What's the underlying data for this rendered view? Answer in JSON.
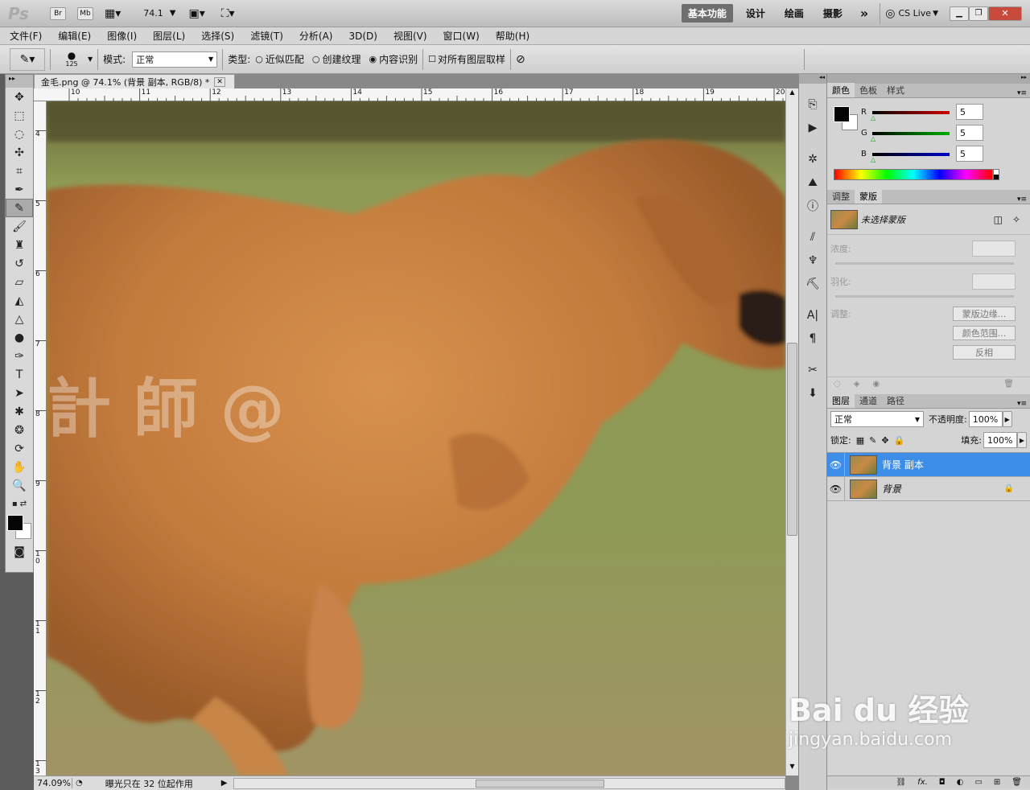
{
  "appbar": {
    "logo": "Ps",
    "zoom": "74.1",
    "workspaces": [
      "基本功能",
      "设计",
      "绘画",
      "摄影"
    ],
    "more": "»",
    "cslive": "CS Live"
  },
  "menu": [
    "文件(F)",
    "编辑(E)",
    "图像(I)",
    "图层(L)",
    "选择(S)",
    "滤镜(T)",
    "分析(A)",
    "3D(D)",
    "视图(V)",
    "窗口(W)",
    "帮助(H)"
  ],
  "options": {
    "brush_size": "125",
    "mode_label": "模式:",
    "mode_value": "正常",
    "type_label": "类型:",
    "type_options": [
      "近似匹配",
      "创建纹理",
      "内容识别"
    ],
    "type_selected": 2,
    "sample_all_label": "对所有图层取样"
  },
  "document": {
    "tab_title": "金毛.png @ 74.1% (背景 副本, RGB/8) *",
    "ruler_h": [
      "10",
      "11",
      "12",
      "13",
      "14",
      "15",
      "16",
      "17",
      "18",
      "19",
      "20"
    ],
    "ruler_v": [
      "4",
      "5",
      "6",
      "7",
      "8",
      "9",
      "1\n0",
      "1\n1",
      "1\n2",
      "1\n3"
    ],
    "watermark_text": "計 師 @",
    "zoom_status": "74.09%",
    "status_text": "曝光只在 32 位起作用"
  },
  "color_panel": {
    "tabs": [
      "颜色",
      "色板",
      "样式"
    ],
    "channels": [
      {
        "label": "R",
        "value": "5",
        "color": "#d00000"
      },
      {
        "label": "G",
        "value": "5",
        "color": "#00b000"
      },
      {
        "label": "B",
        "value": "5",
        "color": "#0000d0"
      }
    ]
  },
  "mask_panel": {
    "tabs": [
      "调整",
      "蒙版"
    ],
    "title": "未选择蒙版",
    "density_label": "浓度:",
    "feather_label": "羽化:",
    "adjust_label": "调整:",
    "buttons": [
      "蒙版边缘...",
      "颜色范围...",
      "反相"
    ]
  },
  "layers_panel": {
    "tabs": [
      "图层",
      "通道",
      "路径"
    ],
    "blend_mode": "正常",
    "opacity_label": "不透明度:",
    "opacity_value": "100%",
    "lock_label": "锁定:",
    "fill_label": "填充:",
    "fill_value": "100%",
    "layers": [
      {
        "name": "背景 副本",
        "selected": true
      },
      {
        "name": "背景",
        "selected": false
      }
    ]
  },
  "baidu_watermark": {
    "line1": "Bai du 经验",
    "line2": "jingyan.baidu.com"
  }
}
